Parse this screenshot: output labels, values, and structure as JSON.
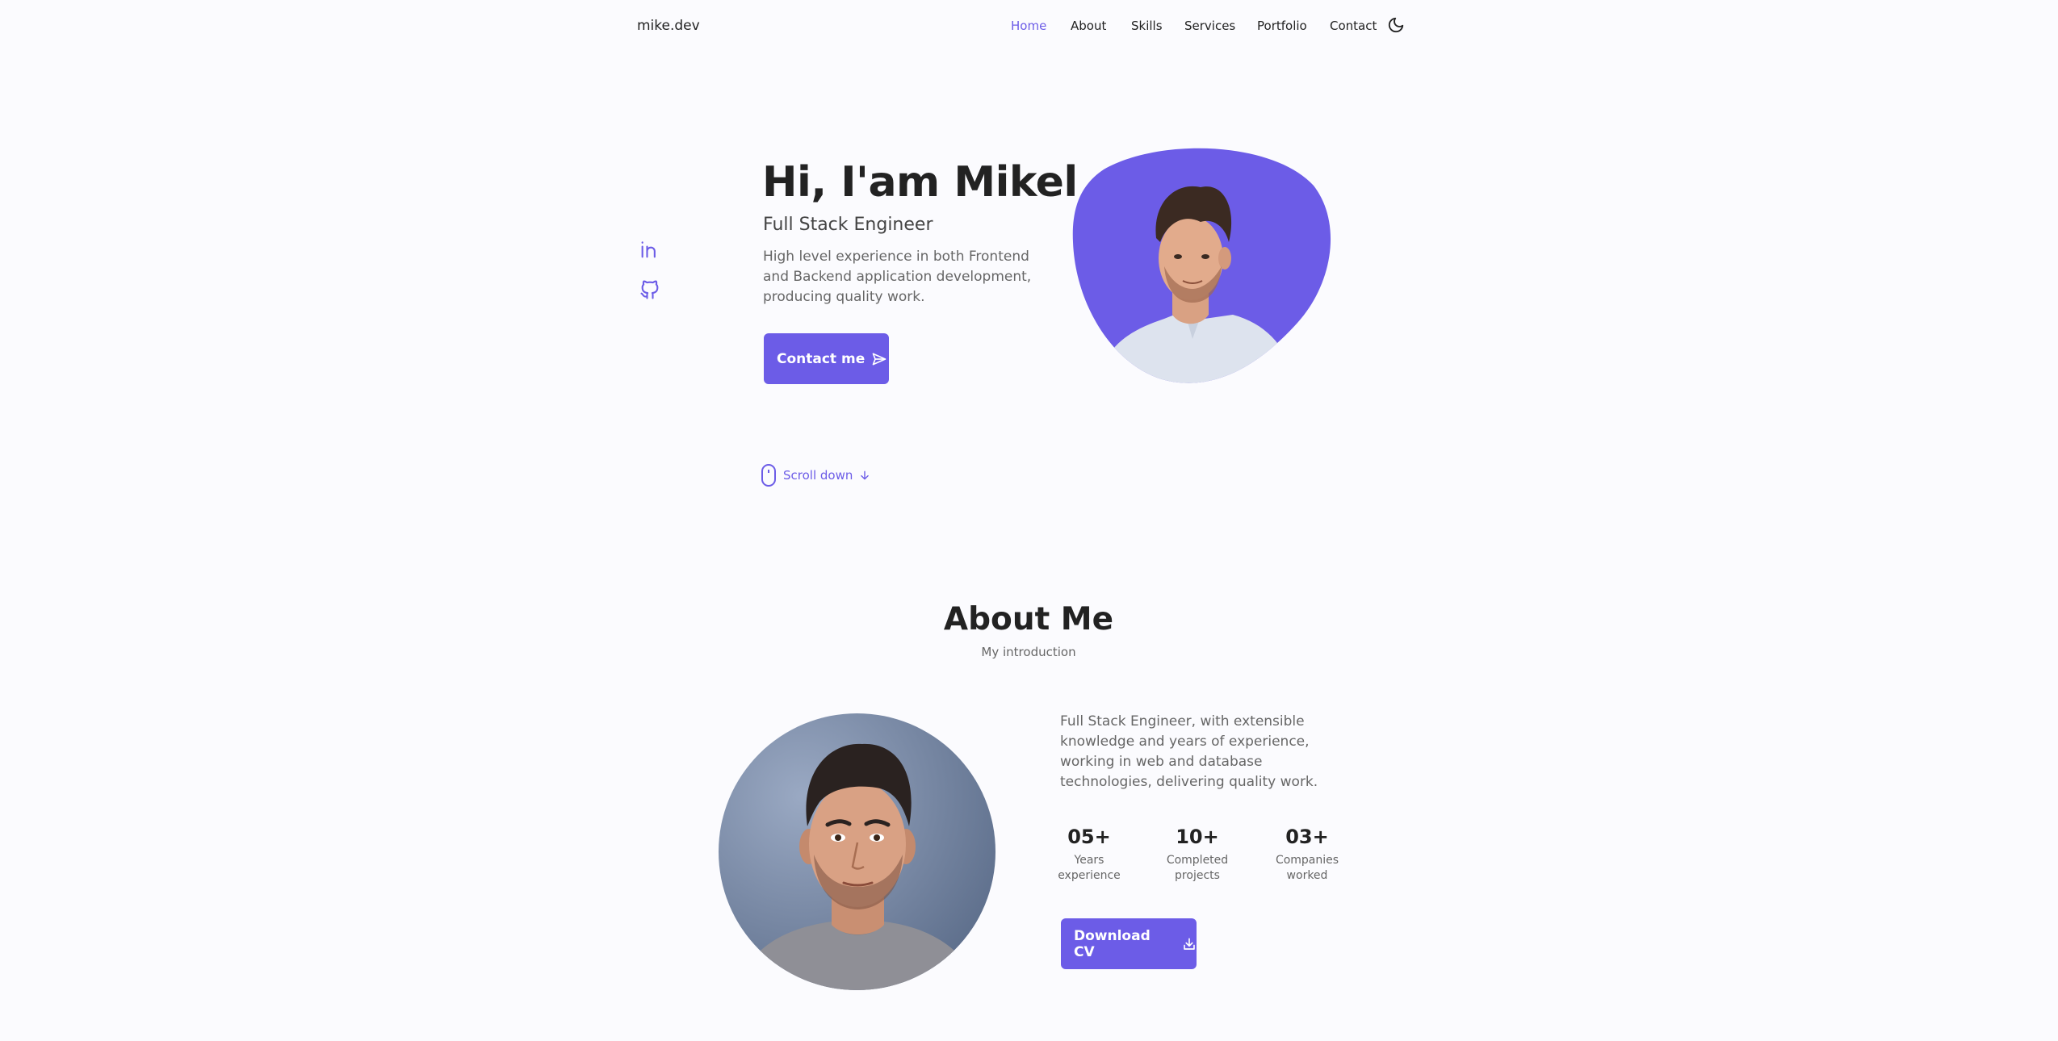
{
  "header": {
    "logo": "mike.dev",
    "nav": [
      {
        "label": "Home",
        "active": true
      },
      {
        "label": "About"
      },
      {
        "label": "Skills"
      },
      {
        "label": "Services"
      },
      {
        "label": "Portfolio"
      },
      {
        "label": "Contact"
      }
    ],
    "theme_icon": "moon-icon"
  },
  "social": [
    {
      "name": "linkedin",
      "icon": "linkedin-icon"
    },
    {
      "name": "github",
      "icon": "github-icon"
    }
  ],
  "hero": {
    "title": "Hi, I'am Mikel",
    "subtitle": "Full Stack Engineer",
    "description": "High level experience in both Frontend and Backend application development, producing quality work.",
    "contact_button": "Contact me",
    "contact_icon": "send-icon",
    "scroll_label": "Scroll down",
    "scroll_icon": "mouse-icon",
    "arrow_icon": "arrow-down-icon"
  },
  "about": {
    "title": "About Me",
    "subtitle": "My introduction",
    "description": "Full Stack Engineer, with extensible knowledge and years of experience, working in web and database technologies, delivering quality work.",
    "stats": [
      {
        "value": "05+",
        "label_line1": "Years",
        "label_line2": "experience"
      },
      {
        "value": "10+",
        "label_line1": "Completed",
        "label_line2": "projects"
      },
      {
        "value": "03+",
        "label_line1": "Companies",
        "label_line2": "worked"
      }
    ],
    "cv_button": "Download CV",
    "cv_icon": "download-icon"
  },
  "colors": {
    "accent": "#6c5ce7",
    "background": "#fbfbfe",
    "text": "#222222",
    "muted": "#666666"
  }
}
